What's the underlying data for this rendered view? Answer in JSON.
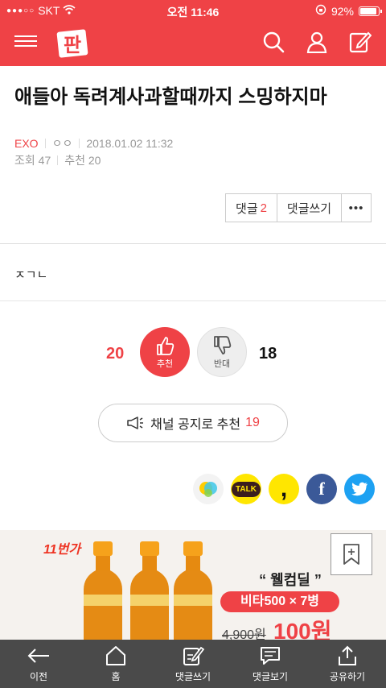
{
  "status_bar": {
    "carrier": "SKT",
    "time": "오전 11:46",
    "battery": "92%"
  },
  "header": {
    "logo_text": "판"
  },
  "post": {
    "title": "애들아 독려계사과할때까지 스밍하지마",
    "category": "EXO",
    "author": "ㅇㅇ",
    "date": "2018.01.02 11:32",
    "views_label": "조회",
    "views": "47",
    "recommend_label": "추천",
    "recommend": "20",
    "comment_label": "댓글",
    "comment_count": "2",
    "write_comment_label": "댓글쓰기",
    "more_label": "•••",
    "body": "ㅈㄱㄴ"
  },
  "vote": {
    "up_count": "20",
    "up_label": "추천",
    "down_label": "반대",
    "down_count": "18"
  },
  "notice_button": {
    "label": "채널 공지로 추천",
    "count": "19"
  },
  "share": {
    "talk_label": "TALK",
    "kakao_glyph": ",",
    "facebook_glyph": "f"
  },
  "ad": {
    "brand": "11번가",
    "welcome": "“ 웰컴딜 ”",
    "deal": "비타500 × 7병",
    "old_price": "4,900원",
    "new_price": "100원"
  },
  "bottom_nav": [
    {
      "label": "이전"
    },
    {
      "label": "홈"
    },
    {
      "label": "댓글쓰기"
    },
    {
      "label": "댓글보기"
    },
    {
      "label": "공유하기"
    }
  ],
  "colors": {
    "brand": "#ef4246",
    "bottom_bar": "#4a4a4a"
  }
}
